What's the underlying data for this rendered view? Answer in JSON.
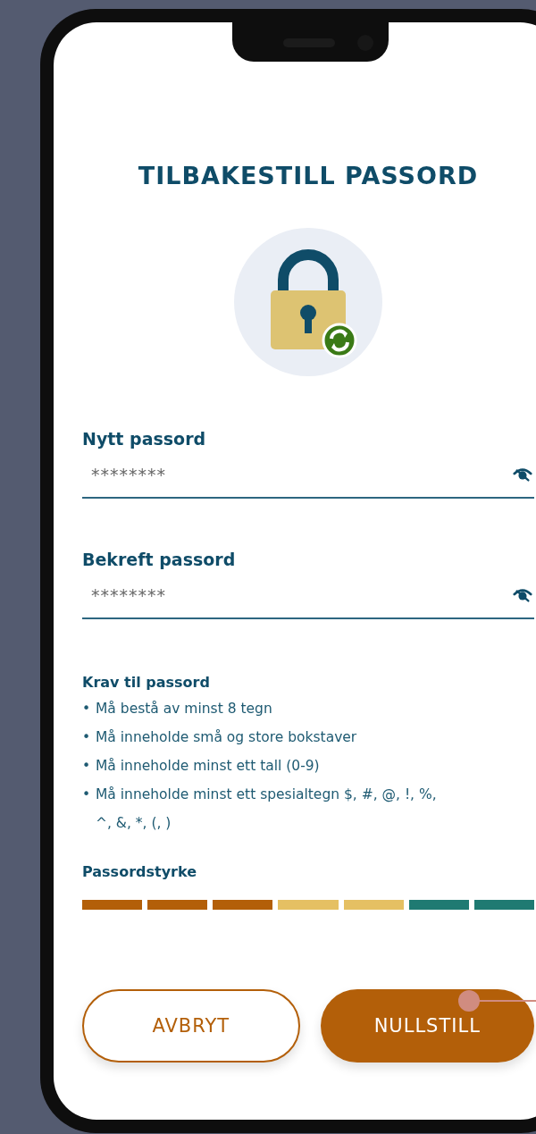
{
  "title": "TILBAKESTILL PASSORD",
  "fields": [
    {
      "label": "Nytt passord",
      "value": "********"
    },
    {
      "label": "Bekreft passord",
      "value": "********"
    }
  ],
  "requirements": {
    "heading": "Krav til passord",
    "items": [
      {
        "bullet": "•",
        "text": "Må bestå av minst 8 tegn"
      },
      {
        "bullet": "•",
        "text": "Må inneholde små og store bokstaver"
      },
      {
        "bullet": "•",
        "text": "Må inneholde minst ett tall (0-9)"
      },
      {
        "bullet": "•",
        "text": "Må inneholde minst ett spesialtegn $, #, @, !, %, ^, &, *, (, )"
      }
    ]
  },
  "strength": {
    "label": "Passordstyrke",
    "segments": [
      {
        "color": "#b35f09"
      },
      {
        "color": "#b35f09"
      },
      {
        "color": "#b35f09"
      },
      {
        "color": "#e5c063"
      },
      {
        "color": "#e5c063"
      },
      {
        "color": "#1f7a72"
      },
      {
        "color": "#1f7a72"
      }
    ]
  },
  "buttons": [
    {
      "label": "AVBRYT",
      "kind": "secondary"
    },
    {
      "label": "NULLSTILL",
      "kind": "primary"
    }
  ]
}
